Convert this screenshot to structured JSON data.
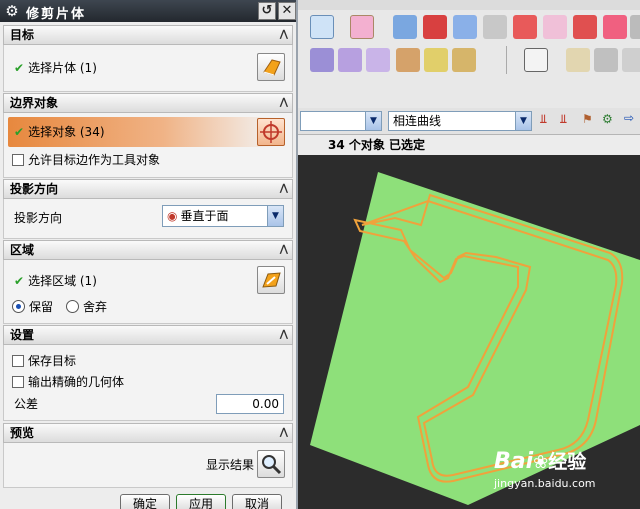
{
  "dialog": {
    "title": "修剪片体",
    "sections": {
      "target": {
        "title": "目标",
        "select_label": "选择片体 (1)"
      },
      "boundary": {
        "title": "边界对象",
        "select_label": "选择对象 (34)",
        "allow_edge_label": "允许目标边作为工具对象"
      },
      "projection": {
        "title": "投影方向",
        "label": "投影方向",
        "value": "垂直于面"
      },
      "region": {
        "title": "区域",
        "select_label": "选择区域 (1)",
        "keep_label": "保留",
        "discard_label": "舍弃"
      },
      "settings": {
        "title": "设置",
        "save_target_label": "保存目标",
        "precise_label": "输出精确的几何体",
        "tolerance_label": "公差",
        "tolerance_value": "0.00"
      },
      "preview": {
        "title": "预览",
        "show_result_label": "显示结果"
      }
    },
    "buttons": {
      "ok": "确定",
      "apply": "应用",
      "cancel": "取消"
    }
  },
  "selection_bar": {
    "curve_rule": "相连曲线"
  },
  "status": {
    "text": "34 个对象 已选定"
  },
  "watermark": {
    "brand": "Bai",
    "brand2": "经验",
    "url": "jingyan.baidu.com"
  },
  "colors": {
    "sheet": "#8ee07a",
    "boundary_curve": "#f0a23c",
    "highlight": "#e7883e",
    "viewport_bg": "#2c2c2c"
  }
}
